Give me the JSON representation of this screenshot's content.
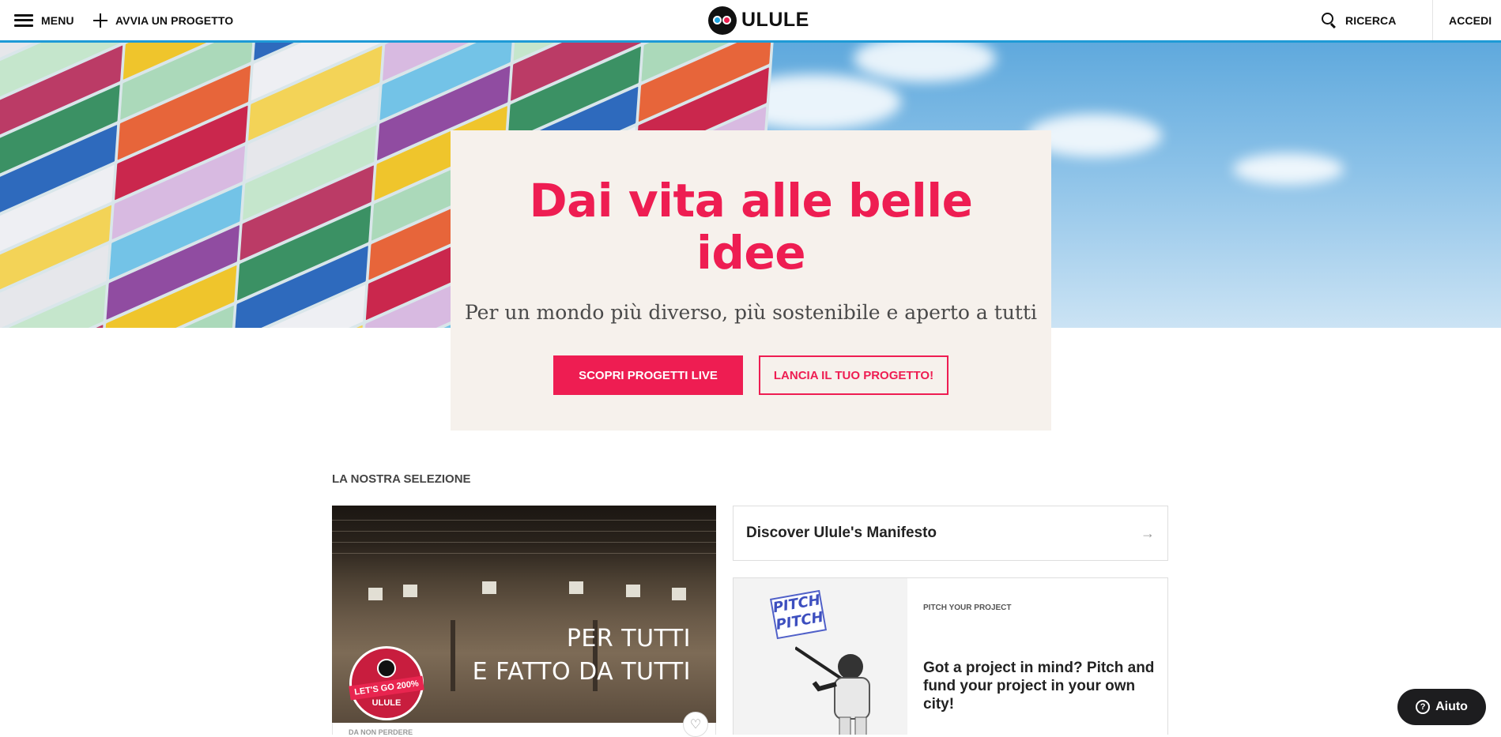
{
  "header": {
    "menu_label": "MENU",
    "start_project_label": "AVVIA UN PROGETTO",
    "logo_text": "ULULE",
    "search_label": "RICERCA",
    "login_label": "ACCEDI",
    "accent_color": "#1e9ad6"
  },
  "hero": {
    "title": "Dai vita alle belle idee",
    "subtitle": "Per un mondo più diverso, più sostenibile e aperto a tutti",
    "primary_button": "SCOPRI PROGETTI LIVE",
    "secondary_button": "LANCIA IL TUO PROGETTO!",
    "brand_color": "#ee1d52"
  },
  "selection": {
    "title": "LA NOSTRA SELEZIONE",
    "featured_project": {
      "image_text_line1": "PER TUTTI",
      "image_text_line2": "E FATTO DA TUTTI",
      "badge_text": "LET'S GO 200%",
      "badge_brand": "ULULE",
      "footer_text": "DA NON PERDERE"
    },
    "manifesto": {
      "label": "Discover Ulule's Manifesto",
      "icon": "arrow-right-icon"
    },
    "pitch": {
      "stamp_text": "PITCH PITCH",
      "kicker": "PITCH YOUR PROJECT",
      "text": "Got a project in mind? Pitch and fund your project in your own city!"
    }
  },
  "help_button": {
    "label": "Aiuto",
    "icon": "question-icon"
  }
}
